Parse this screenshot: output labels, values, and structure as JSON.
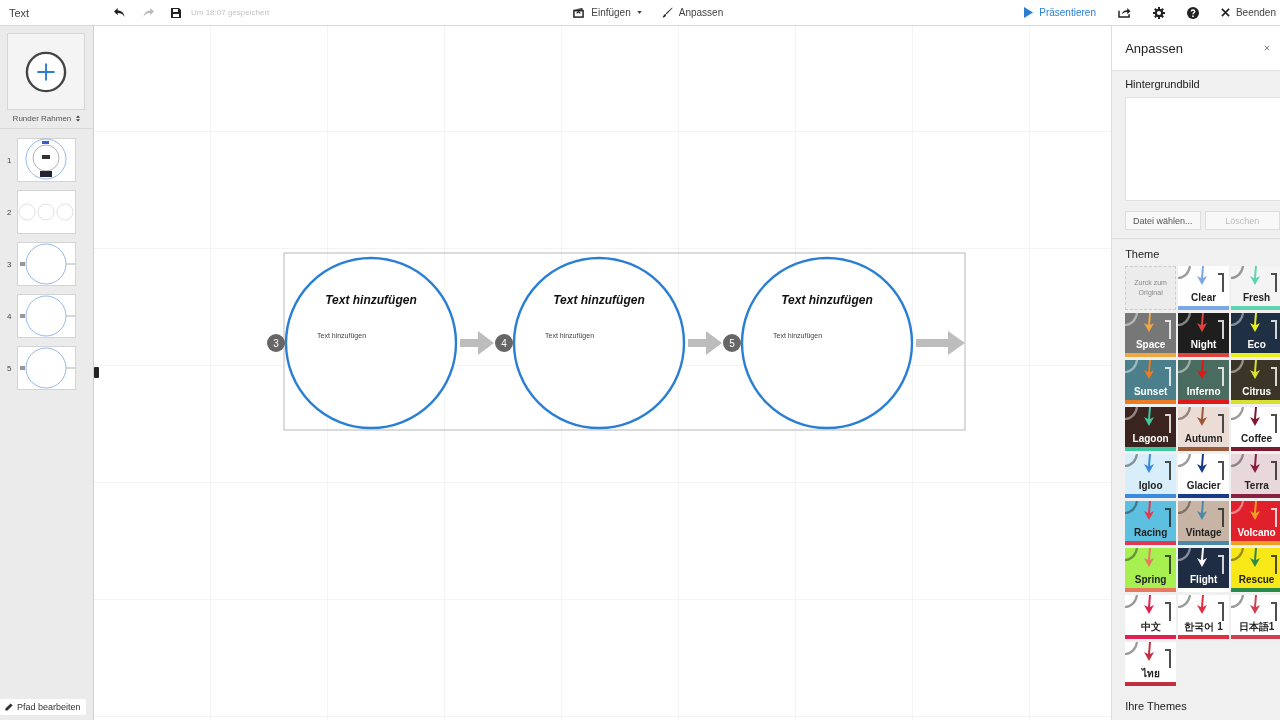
{
  "toolbar": {
    "title": "Text",
    "undo_disabled": false,
    "redo_disabled": true,
    "save_status": "Um 18:07 gespeichert",
    "insert": "Einfügen",
    "customize": "Anpassen",
    "present": "Präsentieren",
    "exit": "Beenden"
  },
  "sidebar": {
    "frame_type": "Runder Rahmen",
    "slides": [
      {
        "number": "1",
        "kind": "overview"
      },
      {
        "number": "2",
        "kind": "row"
      },
      {
        "number": "3",
        "kind": "circle"
      },
      {
        "number": "4",
        "kind": "circle"
      },
      {
        "number": "5",
        "kind": "circle"
      }
    ],
    "edit_path": "Pfad bearbeiten"
  },
  "canvas": {
    "frames": [
      {
        "number": "3",
        "title": "Text hinzufügen",
        "body": "Text hinzufügen"
      },
      {
        "number": "4",
        "title": "Text hinzufügen",
        "body": "Text hinzufügen"
      },
      {
        "number": "5",
        "title": "Text hinzufügen",
        "body": "Text hinzufügen"
      }
    ]
  },
  "panel": {
    "title": "Anpassen",
    "background_label": "Hintergrundbild",
    "choose_file": "Datei wählen...",
    "delete": "Löschen",
    "delete_disabled": true,
    "theme_label": "Theme",
    "themes": [
      {
        "kind": "reset",
        "label": "Zurck zum Original"
      },
      {
        "kind": "theme",
        "label": "Clear",
        "color": "#ffffff",
        "arrow": {
          "color": "#7aa7e8"
        }
      },
      {
        "kind": "theme",
        "label": "Fresh",
        "color": "#f4f4f4",
        "arrow": {
          "color": "#5fd3b0"
        }
      },
      {
        "kind": "theme",
        "label": "Space",
        "color": "#777777",
        "arrow": {
          "color": "#f0a840"
        }
      },
      {
        "kind": "theme",
        "label": "Night",
        "color": "#1e1e1e",
        "arrow": {
          "color": "#e0443c"
        }
      },
      {
        "kind": "theme",
        "label": "Eco",
        "color": "#1f2f44",
        "arrow": {
          "color": "#e8f020"
        }
      },
      {
        "kind": "theme",
        "label": "Sunset",
        "color": "#4b7f8c",
        "arrow": {
          "color": "#f07a20"
        }
      },
      {
        "kind": "theme",
        "label": "Inferno",
        "color": "#4a6b60",
        "arrow": {
          "color": "#e01818"
        }
      },
      {
        "kind": "theme",
        "label": "Citrus",
        "color": "#3a3526",
        "arrow": {
          "color": "#d8e030"
        }
      },
      {
        "kind": "theme",
        "label": "Lagoon",
        "color": "#3b2420",
        "arrow": {
          "color": "#40c8a0"
        }
      },
      {
        "kind": "theme",
        "label": "Autumn",
        "color": "#ecdcd6",
        "arrow": {
          "color": "#9a5a3a"
        }
      },
      {
        "kind": "theme",
        "label": "Coffee",
        "color": "#ffffff",
        "arrow": {
          "color": "#7a1a30"
        }
      },
      {
        "kind": "theme",
        "label": "Igloo",
        "color": "#d8eefa",
        "arrow": {
          "color": "#3a8ae0"
        }
      },
      {
        "kind": "theme",
        "label": "Glacier",
        "color": "#ffffff",
        "arrow": {
          "color": "#1a3a8a"
        }
      },
      {
        "kind": "theme",
        "label": "Terra",
        "color": "#e8d8dc",
        "arrow": {
          "color": "#8a2040"
        }
      },
      {
        "kind": "theme",
        "label": "Racing",
        "color": "#5ec0e0",
        "arrow": {
          "color": "#e03a50"
        }
      },
      {
        "kind": "theme",
        "label": "Vintage",
        "color": "#c8b4a4",
        "arrow": {
          "color": "#4a8aa8"
        }
      },
      {
        "kind": "theme",
        "label": "Volcano",
        "color": "#e0202a",
        "arrow": {
          "color": "#f0a020"
        }
      },
      {
        "kind": "theme",
        "label": "Spring",
        "color": "#a8f050",
        "arrow": {
          "color": "#e87a60"
        }
      },
      {
        "kind": "theme",
        "label": "Flight",
        "color": "#1e2c44",
        "arrow": {
          "color": "#ffffff"
        }
      },
      {
        "kind": "theme",
        "label": "Rescue",
        "color": "#f8e818",
        "arrow": {
          "color": "#2a8a4a"
        }
      },
      {
        "kind": "theme",
        "label": "中文",
        "color": "#ffffff",
        "arrow": {
          "color": "#e02050"
        }
      },
      {
        "kind": "theme",
        "label": "한국어 1",
        "color": "#ffffff",
        "arrow": {
          "color": "#e03040"
        }
      },
      {
        "kind": "theme",
        "label": "日本語1",
        "color": "#ffffff",
        "arrow": {
          "color": "#d04050"
        }
      },
      {
        "kind": "theme",
        "label": "ไทย",
        "color": "#ffffff",
        "arrow": {
          "color": "#c03040"
        }
      }
    ],
    "your_themes": "Ihre Themes"
  }
}
